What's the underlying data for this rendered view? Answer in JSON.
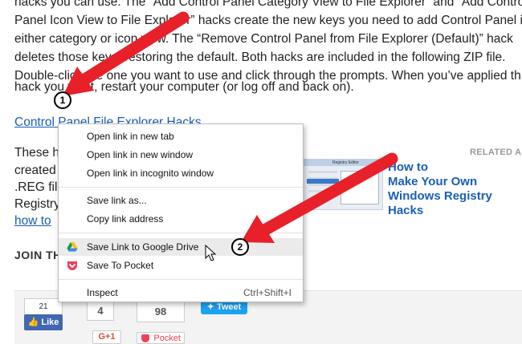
{
  "article": {
    "lines": [
      "hacks you can use. The “Add Control Panel Category View to File Explorer” and “Add Control",
      "Panel Icon View to File Explorer” hacks create the new keys you need to add Control Panel in",
      "either category or icon view. The “Remove Control Panel from File Explorer (Default)” hack",
      "deletes those keys, restoring the default. Both hacks are included in the following ZIP file.",
      "Double-click the one you want to use and click through the prompts. When you’ve applied th",
      "hack you want, restart your computer (or log off and back on)."
    ],
    "download_link": "Control Panel File Explorer Hacks",
    "para2_lines": [
      "These h",
      "created",
      ".REG file",
      "Registry"
    ],
    "how_to_link": "how to"
  },
  "related": {
    "label": "RELATED ARTI",
    "title_lines": [
      "How to",
      "Make Your Own",
      "Windows Registry",
      "Hacks"
    ],
    "thumb_title": "Registry Editor"
  },
  "join_label": "JOIN THE",
  "social": {
    "fb_count": "21",
    "fb_like": "Like",
    "count_4": "4",
    "count_98": "98",
    "gplus": "G+1",
    "tweet": "Tweet",
    "pocket": "Pocket"
  },
  "context_menu": {
    "items": [
      {
        "label": "Open link in new tab"
      },
      {
        "label": "Open link in new window"
      },
      {
        "label": "Open link in incognito window"
      },
      {
        "label": "Save link as..."
      },
      {
        "label": "Copy link address"
      },
      {
        "label": "Save Link to Google Drive",
        "icon": "google-drive-icon"
      },
      {
        "label": "Save To Pocket",
        "icon": "pocket-icon"
      },
      {
        "label": "Inspect",
        "shortcut": "Ctrl+Shift+I"
      }
    ]
  },
  "callouts": {
    "one": "1",
    "two": "2"
  },
  "colors": {
    "link": "#1a5fb4",
    "arrow": "#e8202a",
    "menu_highlight": "#ebebeb",
    "tweet": "#1da1f2",
    "facebook": "#4267b2",
    "pocket": "#ef4056"
  }
}
